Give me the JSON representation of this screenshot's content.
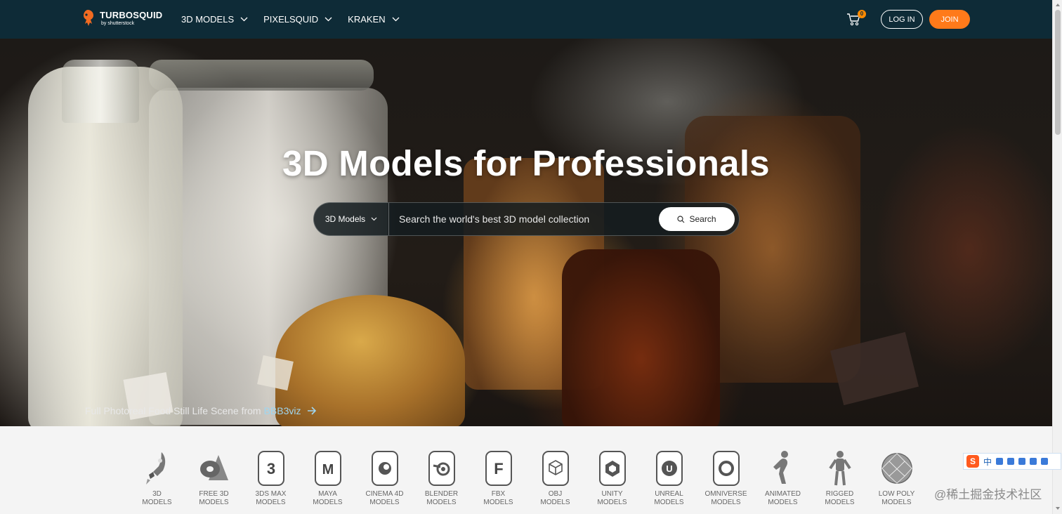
{
  "header": {
    "brand": "TURBOSQUID",
    "brand_sub": "by shutterstock",
    "nav": [
      {
        "label": "3D MODELS"
      },
      {
        "label": "PIXELSQUID"
      },
      {
        "label": "KRAKEN"
      }
    ],
    "cart_count": "0",
    "login_label": "LOG IN",
    "join_label": "JOIN",
    "colors": {
      "bar": "#0e2b37",
      "join": "#ff7a1a",
      "badge": "#ff8a00"
    }
  },
  "hero": {
    "title": "3D Models for Professionals",
    "search": {
      "category": "3D Models",
      "placeholder": "Search the world's best 3D model collection",
      "button_label": "Search"
    },
    "credit": {
      "text": "Full Photoreal Food Still Life Scene from",
      "author": "BBB3viz"
    }
  },
  "categories": [
    {
      "icon": "rocket-icon",
      "line1": "3D",
      "line2": "MODELS"
    },
    {
      "icon": "free-shapes-icon",
      "line1": "FREE 3D",
      "line2": "MODELS"
    },
    {
      "icon": "3ds-max-icon",
      "glyph": "3",
      "line1": "3DS MAX",
      "line2": "MODELS"
    },
    {
      "icon": "maya-icon",
      "glyph": "M",
      "line1": "MAYA",
      "line2": "MODELS"
    },
    {
      "icon": "cinema4d-icon",
      "glyph": "",
      "line1": "CINEMA 4D",
      "line2": "MODELS"
    },
    {
      "icon": "blender-icon",
      "glyph": "",
      "line1": "BLENDER",
      "line2": "MODELS"
    },
    {
      "icon": "fbx-icon",
      "glyph": "F",
      "line1": "FBX",
      "line2": "MODELS"
    },
    {
      "icon": "obj-icon",
      "glyph": "",
      "line1": "OBJ",
      "line2": "MODELS"
    },
    {
      "icon": "unity-icon",
      "glyph": "",
      "line1": "UNITY",
      "line2": "MODELS"
    },
    {
      "icon": "unreal-icon",
      "glyph": "U",
      "line1": "UNREAL",
      "line2": "MODELS"
    },
    {
      "icon": "omniverse-icon",
      "glyph": "O",
      "line1": "OMNIVERSE",
      "line2": "MODELS"
    },
    {
      "icon": "animated-figure-icon",
      "line1": "ANIMATED",
      "line2": "MODELS"
    },
    {
      "icon": "rigged-figure-icon",
      "line1": "RIGGED",
      "line2": "MODELS"
    },
    {
      "icon": "low-poly-sphere-icon",
      "line1": "LOW POLY",
      "line2": "MODELS"
    }
  ],
  "ime": {
    "logo": "S",
    "lang": "中"
  },
  "watermark": "@稀土掘金技术社区"
}
